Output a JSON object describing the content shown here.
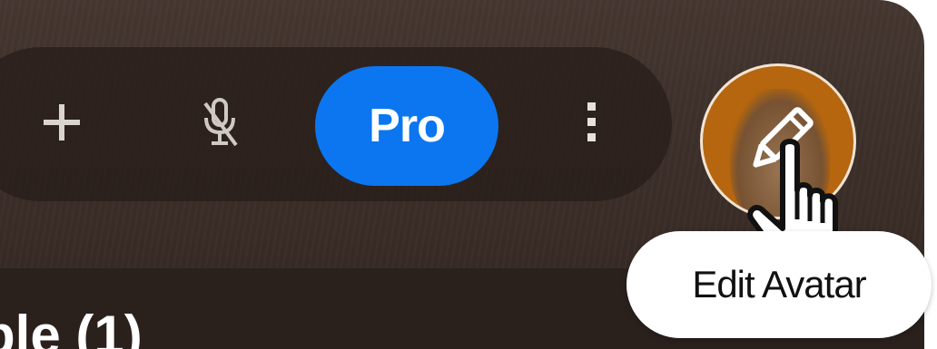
{
  "toolbar": {
    "add_icon": "plus-icon",
    "mic_icon": "microphone-muted-icon",
    "pro_label": "Pro",
    "more_icon": "more-vertical-icon"
  },
  "avatar": {
    "edit_icon": "pencil-icon",
    "tooltip": "Edit Avatar",
    "accent_color": "#b5660e"
  },
  "section": {
    "heading": "ple (1)"
  },
  "colors": {
    "pro_button": "#0b76f0",
    "background": "#3b2e28"
  }
}
